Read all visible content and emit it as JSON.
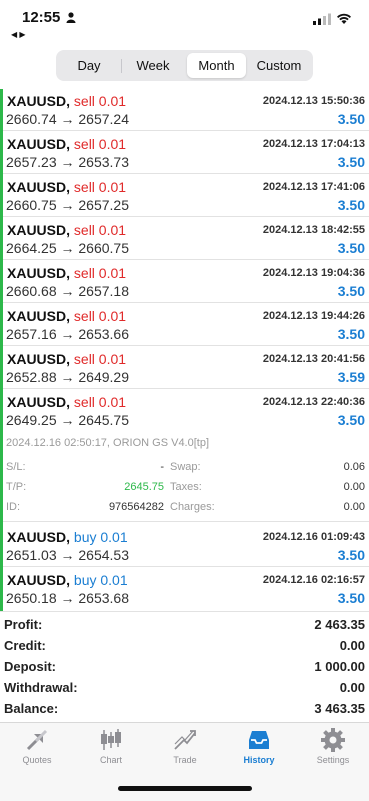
{
  "status": {
    "time": "12:55",
    "back_arrows": "◀ ▶"
  },
  "period_tabs": [
    {
      "label": "Day",
      "selected": false
    },
    {
      "label": "Week",
      "selected": false
    },
    {
      "label": "Month",
      "selected": true
    },
    {
      "label": "Custom",
      "selected": false
    }
  ],
  "trades": [
    {
      "symbol": "XAUUSD,",
      "side": "sell 0.01",
      "prices": "2660.74 → 2657.24",
      "date": "2024.12.13 15:50:36",
      "profit": "3.50"
    },
    {
      "symbol": "XAUUSD,",
      "side": "sell 0.01",
      "prices": "2657.23 → 2653.73",
      "date": "2024.12.13 17:04:13",
      "profit": "3.50"
    },
    {
      "symbol": "XAUUSD,",
      "side": "sell 0.01",
      "prices": "2660.75 → 2657.25",
      "date": "2024.12.13 17:41:06",
      "profit": "3.50"
    },
    {
      "symbol": "XAUUSD,",
      "side": "sell 0.01",
      "prices": "2664.25 → 2660.75",
      "date": "2024.12.13 18:42:55",
      "profit": "3.50"
    },
    {
      "symbol": "XAUUSD,",
      "side": "sell 0.01",
      "prices": "2660.68 → 2657.18",
      "date": "2024.12.13 19:04:36",
      "profit": "3.50"
    },
    {
      "symbol": "XAUUSD,",
      "side": "sell 0.01",
      "prices": "2657.16 → 2653.66",
      "date": "2024.12.13 19:44:26",
      "profit": "3.50"
    },
    {
      "symbol": "XAUUSD,",
      "side": "sell 0.01",
      "prices": "2652.88 → 2649.29",
      "date": "2024.12.13 20:41:56",
      "profit": "3.59"
    },
    {
      "symbol": "XAUUSD,",
      "side": "sell 0.01",
      "prices": "2649.25 → 2645.75",
      "date": "2024.12.13 22:40:36",
      "profit": "3.50"
    }
  ],
  "detail": {
    "header": "2024.12.16 02:50:17, ORION GS V4.0[tp]",
    "sl_label": "S/L:",
    "sl_value": "-",
    "tp_label": "T/P:",
    "tp_value": "2645.75",
    "id_label": "ID:",
    "id_value": "976564282",
    "swap_label": "Swap:",
    "swap_value": "0.06",
    "taxes_label": "Taxes:",
    "taxes_value": "0.00",
    "charges_label": "Charges:",
    "charges_value": "0.00"
  },
  "trades2": [
    {
      "symbol": "XAUUSD,",
      "side": "buy 0.01",
      "prices": "2651.03 → 2654.53",
      "date": "2024.12.16 01:09:43",
      "profit": "3.50"
    },
    {
      "symbol": "XAUUSD,",
      "side": "buy 0.01",
      "prices": "2650.18 → 2653.68",
      "date": "2024.12.16 02:16:57",
      "profit": "3.50"
    }
  ],
  "summary": [
    {
      "label": "Profit:",
      "value": "2 463.35"
    },
    {
      "label": "Credit:",
      "value": "0.00"
    },
    {
      "label": "Deposit:",
      "value": "1 000.00"
    },
    {
      "label": "Withdrawal:",
      "value": "0.00"
    },
    {
      "label": "Balance:",
      "value": "3 463.35"
    }
  ],
  "tabbar": [
    {
      "label": "Quotes",
      "icon": "quotes-icon",
      "active": false
    },
    {
      "label": "Chart",
      "icon": "chart-icon",
      "active": false
    },
    {
      "label": "Trade",
      "icon": "trade-icon",
      "active": false
    },
    {
      "label": "History",
      "icon": "history-icon",
      "active": true
    },
    {
      "label": "Settings",
      "icon": "settings-icon",
      "active": false
    }
  ],
  "colors": {
    "sell": "#e02a2a",
    "buy": "#1b7ed2",
    "profit": "#1b7ed2",
    "tp": "#2db84a",
    "active_tab": "#1b7ed2"
  }
}
